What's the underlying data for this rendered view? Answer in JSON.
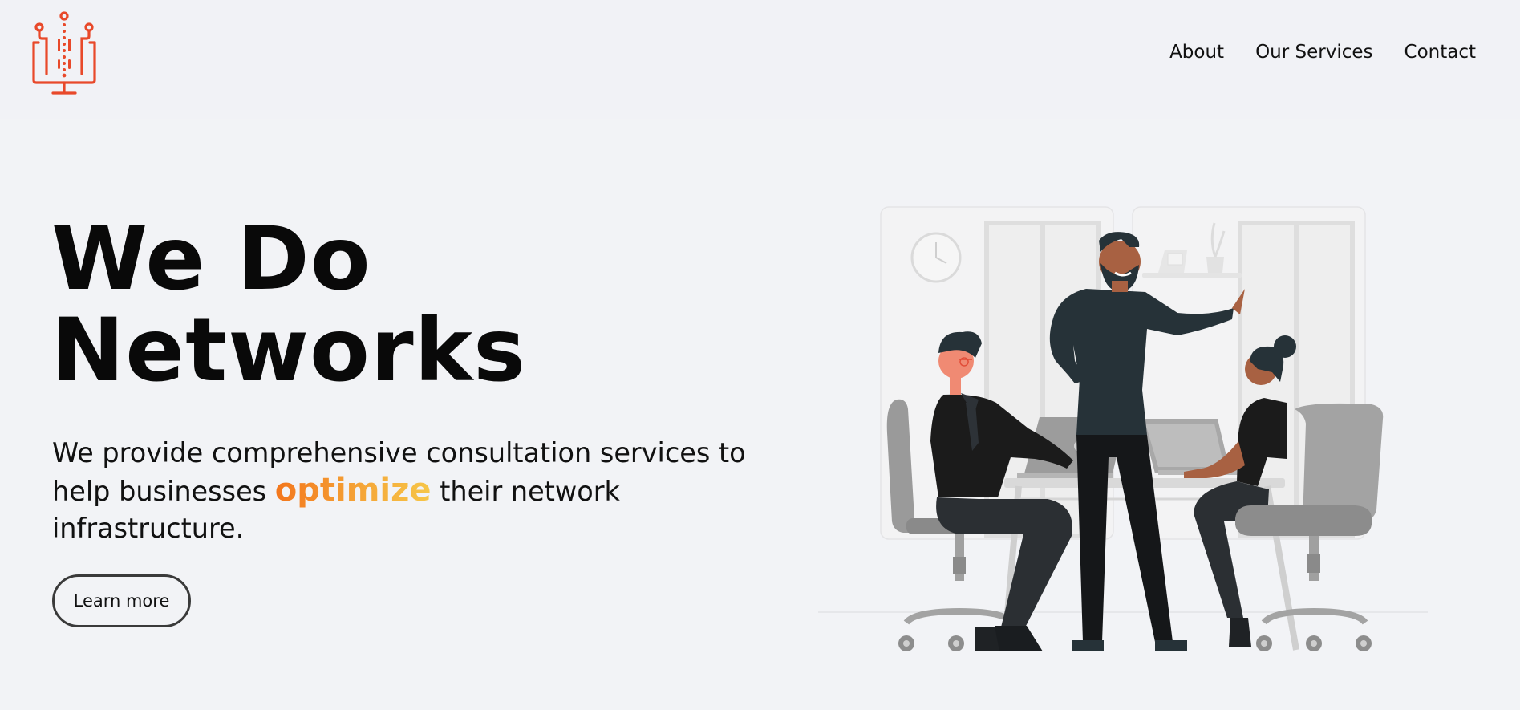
{
  "header": {
    "logo_icon": "network-monitor-icon",
    "nav": [
      {
        "label": "About"
      },
      {
        "label": "Our Services"
      },
      {
        "label": "Contact"
      }
    ]
  },
  "hero": {
    "title_line1": "We Do",
    "title_line2": "Networks",
    "text_before": "We provide comprehensive consultation services to help businesses ",
    "text_highlight": "optimize",
    "text_after": " their network infrastructure.",
    "cta_label": "Learn more"
  },
  "illustration": {
    "icon": "team-meeting-illustration"
  },
  "colors": {
    "logo": "#e8492a",
    "highlight_start": "#f3761c",
    "highlight_end": "#f6c648",
    "background": "#f2f3f6"
  }
}
